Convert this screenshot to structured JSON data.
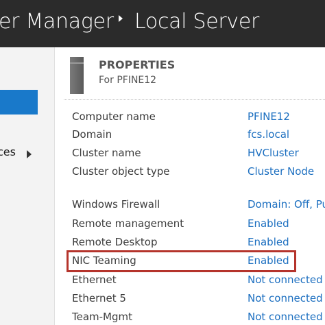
{
  "header": {
    "breadcrumb_part1": "er Manager",
    "breadcrumb_part2": "Local Server"
  },
  "sidebar": {
    "partial_item": "ces"
  },
  "properties": {
    "title": "PROPERTIES",
    "subtitle": "For PFINE12",
    "rows": [
      {
        "label": "Computer name",
        "value": "PFINE12"
      },
      {
        "label": "Domain",
        "value": "fcs.local"
      },
      {
        "label": "Cluster name",
        "value": "HVCluster"
      },
      {
        "label": "Cluster object type",
        "value": "Cluster Node"
      },
      {
        "label": "Windows Firewall",
        "value": "Domain: Off, Pu"
      },
      {
        "label": "Remote management",
        "value": "Enabled"
      },
      {
        "label": "Remote Desktop",
        "value": "Enabled"
      },
      {
        "label": "NIC Teaming",
        "value": "Enabled"
      },
      {
        "label": "Ethernet",
        "value": "Not connected"
      },
      {
        "label": "Ethernet 5",
        "value": "Not connected"
      },
      {
        "label": "Team-Mgmt",
        "value": "Not connected"
      }
    ]
  },
  "colors": {
    "titlebar": "#2b2b2b",
    "nav_selected": "#1979ca",
    "link": "#1c6fc0",
    "highlight_box": "#b5342c"
  }
}
